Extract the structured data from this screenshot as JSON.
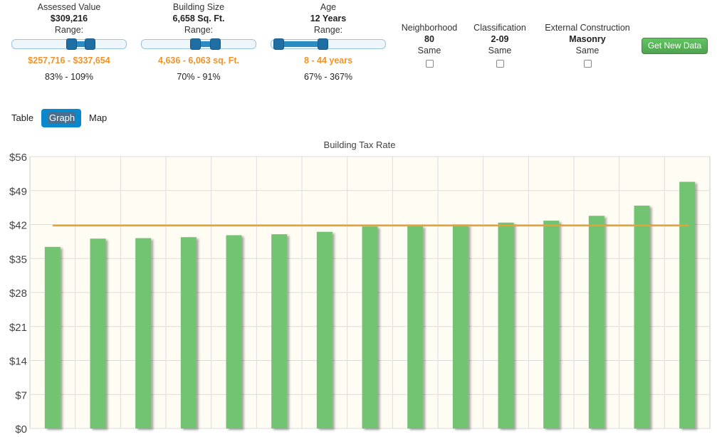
{
  "filters": [
    {
      "label": "Assessed Value",
      "value": "$309,216",
      "range_label": "Range:",
      "range_text": "$257,716 - $337,654",
      "percent_text": "83% - 109%",
      "slider_low_frac": 0.52,
      "slider_high_frac": 0.68
    },
    {
      "label": "Building Size",
      "value": "6,658 Sq. Ft.",
      "range_label": "Range:",
      "range_text": "4,636 - 6,063 sq. Ft.",
      "percent_text": "70% - 91%",
      "slider_low_frac": 0.47,
      "slider_high_frac": 0.64
    },
    {
      "label": "Age",
      "value": "12 Years",
      "range_label": "Range:",
      "range_text": "8 - 44 years",
      "percent_text": "67% - 367%",
      "slider_low_frac": 0.07,
      "slider_high_frac": 0.45
    }
  ],
  "attributes": [
    {
      "label": "Neighborhood",
      "value": "80",
      "match": "Same",
      "checked": false
    },
    {
      "label": "Classification",
      "value": "2-09",
      "match": "Same",
      "checked": false
    },
    {
      "label": "External Construction",
      "value": "Masonry",
      "match": "Same",
      "checked": false
    }
  ],
  "get_new_data_label": "Get New Data",
  "view_tabs": [
    {
      "label": "Table",
      "active": false
    },
    {
      "label": "Graph",
      "active": true
    },
    {
      "label": "Map",
      "active": false
    }
  ],
  "chart_data": {
    "type": "bar",
    "title": "Building Tax Rate",
    "xlabel": "",
    "ylabel": "",
    "ylim": [
      0,
      56
    ],
    "yticks": [
      "$0",
      "$7",
      "$14",
      "$21",
      "$28",
      "$35",
      "$42",
      "$49",
      "$56"
    ],
    "grid": true,
    "values": [
      37.4,
      39.1,
      39.2,
      39.4,
      39.8,
      40.0,
      40.5,
      41.6,
      41.7,
      42.0,
      42.4,
      42.8,
      43.8,
      45.9,
      50.8
    ],
    "reference_line": 41.8,
    "bar_color": "#72c472",
    "line_color": "#e4a23a",
    "plot_bg": "#fffcf3"
  }
}
